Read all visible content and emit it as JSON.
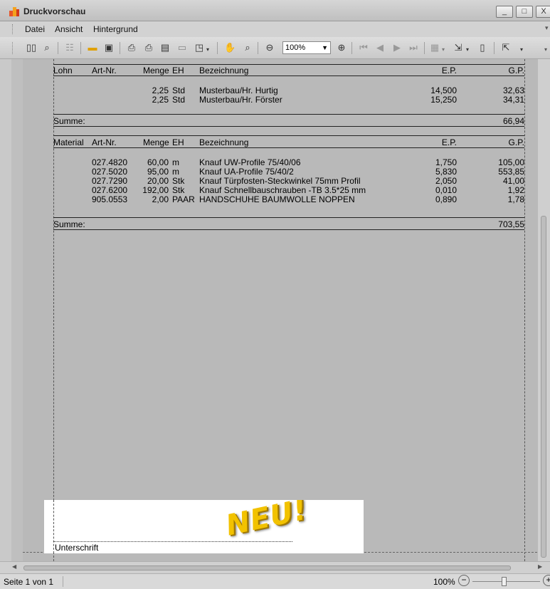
{
  "window": {
    "title": "Druckvorschau",
    "minimize": "_",
    "maximize": "□",
    "close": "X"
  },
  "menu": [
    "Datei",
    "Ansicht",
    "Hintergrund"
  ],
  "toolbar": {
    "zoom_value": "100%"
  },
  "report": {
    "lohn": {
      "headers": {
        "section": "Lohn",
        "art_nr": "Art-Nr.",
        "menge": "Menge",
        "eh": "EH",
        "bezeichnung": "Bezeichnung",
        "ep": "E.P.",
        "gp": "G.P."
      },
      "rows": [
        {
          "art_nr": "",
          "menge": "2,25",
          "eh": "Std",
          "bezeichnung": "Musterbau/Hr. Hurtig",
          "ep": "14,500",
          "gp": "32,63"
        },
        {
          "art_nr": "",
          "menge": "2,25",
          "eh": "Std",
          "bezeichnung": "Musterbau/Hr. Förster",
          "ep": "15,250",
          "gp": "34,31"
        }
      ],
      "summe_label": "Summe:",
      "summe_value": "66,94"
    },
    "material": {
      "headers": {
        "section": "Material",
        "art_nr": "Art-Nr.",
        "menge": "Menge",
        "eh": "EH",
        "bezeichnung": "Bezeichnung",
        "ep": "E.P.",
        "gp": "G.P."
      },
      "rows": [
        {
          "art_nr": "027.4820",
          "menge": "60,00",
          "eh": "m",
          "bezeichnung": "Knauf UW-Profile 75/40/06",
          "ep": "1,750",
          "gp": "105,00"
        },
        {
          "art_nr": "027.5020",
          "menge": "95,00",
          "eh": "m",
          "bezeichnung": "Knauf UA-Profile 75/40/2",
          "ep": "5,830",
          "gp": "553,85"
        },
        {
          "art_nr": "027.7290",
          "menge": "20,00",
          "eh": "Stk",
          "bezeichnung": "Knauf Türpfosten-Steckwinkel 75mm Profil",
          "ep": "2,050",
          "gp": "41,00"
        },
        {
          "art_nr": "027.6200",
          "menge": "192,00",
          "eh": "Stk",
          "bezeichnung": "Knauf Schnellbauschrauben  -TB 3.5*25 mm",
          "ep": "0,010",
          "gp": "1,92"
        },
        {
          "art_nr": "905.0553",
          "menge": "2,00",
          "eh": "PAAR",
          "bezeichnung": "HANDSCHUHE BAUMWOLLE NOPPEN",
          "ep": "0,890",
          "gp": "1,78"
        }
      ],
      "summe_label": "Summe:",
      "summe_value": "703,55"
    },
    "signature_label": "Unterschrift",
    "stamp_text": "NEU!"
  },
  "status": {
    "page_info": "Seite 1 von 1",
    "zoom": "100%",
    "zoom_out": "−",
    "zoom_in": "+"
  }
}
